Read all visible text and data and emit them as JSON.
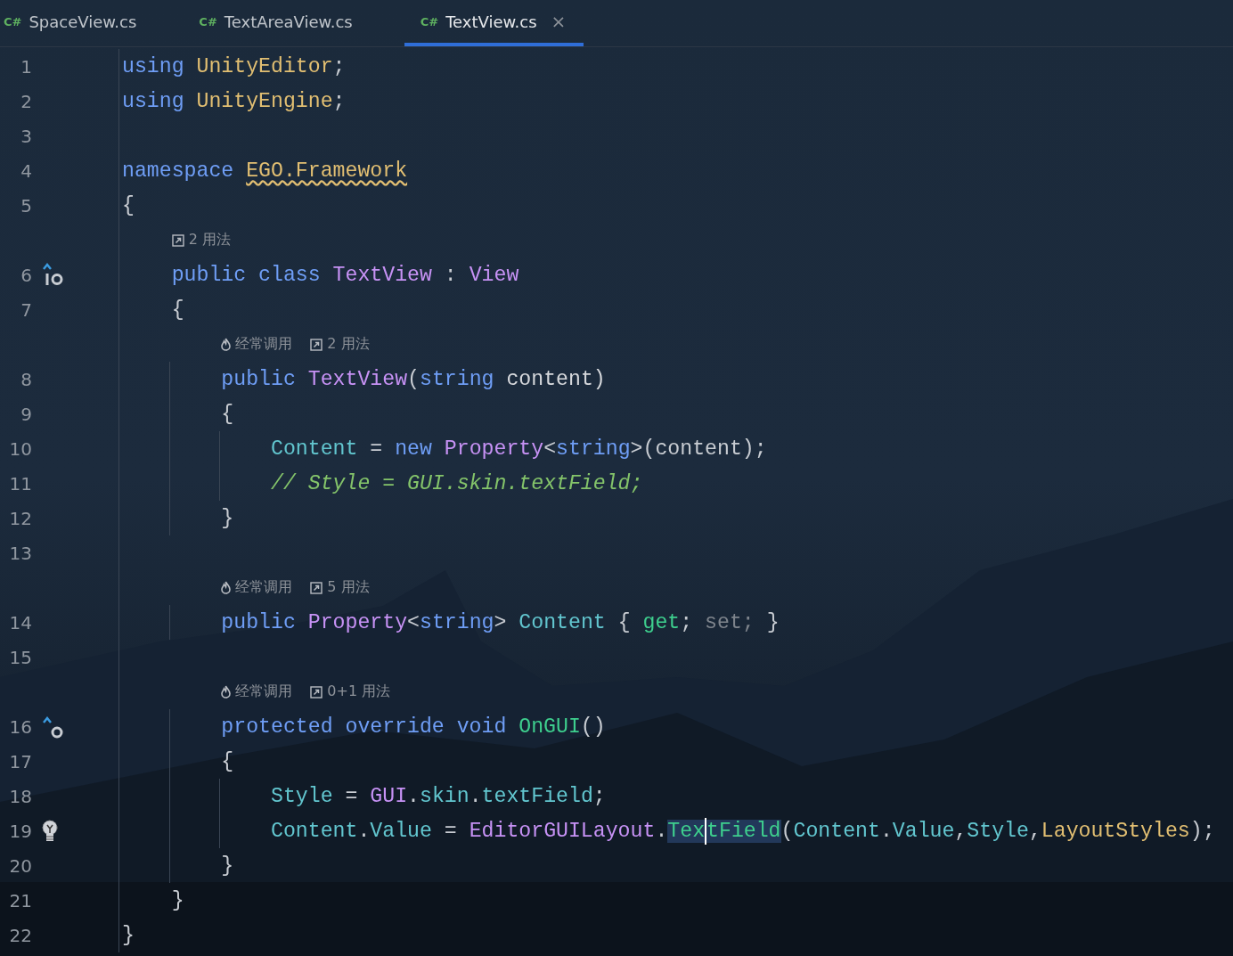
{
  "tabs": [
    {
      "icon_text": "C#",
      "label": "SpaceView.cs",
      "selected": false
    },
    {
      "icon_text": "C#",
      "label": "TextAreaView.cs",
      "selected": false
    },
    {
      "icon_text": "C#",
      "label": "TextView.cs",
      "selected": true,
      "close": "×"
    }
  ],
  "rows": [
    {
      "kind": "code",
      "number": "1",
      "tokens": [
        {
          "text": "using ",
          "kind": "kw"
        },
        {
          "text": "UnityEditor",
          "kind": "ns"
        },
        {
          "text": ";",
          "kind": "punct"
        }
      ]
    },
    {
      "kind": "code",
      "number": "2",
      "tokens": [
        {
          "text": "using ",
          "kind": "kw"
        },
        {
          "text": "UnityEngine",
          "kind": "ns"
        },
        {
          "text": ";",
          "kind": "punct"
        }
      ]
    },
    {
      "kind": "code",
      "number": "3"
    },
    {
      "kind": "code",
      "number": "4",
      "tokens": [
        {
          "text": "namespace ",
          "kind": "kw"
        },
        {
          "text": "EGO.Framework",
          "kind": "warn"
        }
      ]
    },
    {
      "kind": "code",
      "number": "5",
      "tokens": [
        {
          "text": "{",
          "kind": "punct"
        }
      ]
    },
    {
      "kind": "hint",
      "items": [
        {
          "kind": "usages",
          "text": "2 用法"
        }
      ]
    },
    {
      "kind": "code",
      "number": "6",
      "gutter_icon": {
        "kind": "implemented"
      },
      "tokens": [
        {
          "text": "    public class ",
          "kind": "kw"
        },
        {
          "text": "TextView",
          "kind": "type"
        },
        {
          "text": " : ",
          "kind": "punct"
        },
        {
          "text": "View",
          "kind": "type"
        }
      ]
    },
    {
      "kind": "code",
      "number": "7",
      "tokens": [
        {
          "text": "    {",
          "kind": "punct"
        }
      ]
    },
    {
      "kind": "hint",
      "items": [
        {
          "kind": "hot",
          "text": "经常调用"
        },
        {
          "kind": "usages",
          "text": "2 用法"
        }
      ]
    },
    {
      "kind": "code",
      "number": "8",
      "tokens": [
        {
          "text": "        public ",
          "kind": "kw"
        },
        {
          "text": "TextView",
          "kind": "type"
        },
        {
          "text": "(",
          "kind": "punct"
        },
        {
          "text": "string",
          "kind": "kw"
        },
        {
          "text": " content)",
          "kind": "param"
        }
      ]
    },
    {
      "kind": "code",
      "number": "9",
      "tokens": [
        {
          "text": "        {",
          "kind": "punct"
        }
      ]
    },
    {
      "kind": "code",
      "number": "10",
      "tokens": [
        {
          "text": "            Content",
          "kind": "prop"
        },
        {
          "text": " = ",
          "kind": "punct"
        },
        {
          "text": "new ",
          "kind": "kw"
        },
        {
          "text": "Property",
          "kind": "type"
        },
        {
          "text": "<",
          "kind": "punct"
        },
        {
          "text": "string",
          "kind": "kw"
        },
        {
          "text": ">(content);",
          "kind": "punct"
        }
      ]
    },
    {
      "kind": "code",
      "number": "11",
      "tokens": [
        {
          "text": "            // Style = GUI.skin.textField;",
          "kind": "comment"
        }
      ]
    },
    {
      "kind": "code",
      "number": "12",
      "tokens": [
        {
          "text": "        }",
          "kind": "punct"
        }
      ]
    },
    {
      "kind": "code",
      "number": "13"
    },
    {
      "kind": "hint",
      "items": [
        {
          "kind": "hot",
          "text": "经常调用"
        },
        {
          "kind": "usages",
          "text": "5 用法"
        }
      ]
    },
    {
      "kind": "code",
      "number": "14",
      "tokens": [
        {
          "text": "        public ",
          "kind": "kw"
        },
        {
          "text": "Property",
          "kind": "type"
        },
        {
          "text": "<",
          "kind": "punct"
        },
        {
          "text": "string",
          "kind": "kw"
        },
        {
          "text": "> ",
          "kind": "punct"
        },
        {
          "text": "Content",
          "kind": "prop"
        },
        {
          "text": " { ",
          "kind": "punct"
        },
        {
          "text": "get",
          "kind": "method"
        },
        {
          "text": "; ",
          "kind": "punct"
        },
        {
          "text": "set;",
          "kind": "dim"
        },
        {
          "text": " }",
          "kind": "punct"
        }
      ]
    },
    {
      "kind": "code",
      "number": "15"
    },
    {
      "kind": "hint",
      "items": [
        {
          "kind": "hot",
          "text": "经常调用"
        },
        {
          "kind": "usages",
          "text": "0+1 用法"
        }
      ]
    },
    {
      "kind": "code",
      "number": "16",
      "gutter_icon": {
        "kind": "override"
      },
      "tokens": [
        {
          "text": "        protected override void ",
          "kind": "kw"
        },
        {
          "text": "OnGUI",
          "kind": "method"
        },
        {
          "text": "()",
          "kind": "punct"
        }
      ]
    },
    {
      "kind": "code",
      "number": "17",
      "tokens": [
        {
          "text": "        {",
          "kind": "punct"
        }
      ]
    },
    {
      "kind": "code",
      "number": "18",
      "tokens": [
        {
          "text": "            Style",
          "kind": "prop"
        },
        {
          "text": " = ",
          "kind": "punct"
        },
        {
          "text": "GUI",
          "kind": "type"
        },
        {
          "text": ".",
          "kind": "punct"
        },
        {
          "text": "skin",
          "kind": "prop"
        },
        {
          "text": ".",
          "kind": "punct"
        },
        {
          "text": "textField",
          "kind": "prop"
        },
        {
          "text": ";",
          "kind": "punct"
        }
      ]
    },
    {
      "kind": "code",
      "number": "19",
      "gutter_icon": {
        "kind": "bulb"
      },
      "tokens": [
        {
          "text": "            Content",
          "kind": "prop"
        },
        {
          "text": ".",
          "kind": "punct"
        },
        {
          "text": "Value",
          "kind": "prop"
        },
        {
          "text": " = ",
          "kind": "punct"
        },
        {
          "text": "EditorGUILayout",
          "kind": "type"
        },
        {
          "text": ".",
          "kind": "punct"
        },
        {
          "text": "Tex",
          "kind": "hl"
        },
        {
          "kind": "caret"
        },
        {
          "text": "tField",
          "kind": "hl"
        },
        {
          "text": "(",
          "kind": "punct"
        },
        {
          "text": "Content",
          "kind": "prop"
        },
        {
          "text": ".",
          "kind": "punct"
        },
        {
          "text": "Value",
          "kind": "prop"
        },
        {
          "text": ",",
          "kind": "punct"
        },
        {
          "text": "Style",
          "kind": "prop"
        },
        {
          "text": ",",
          "kind": "punct"
        },
        {
          "text": "LayoutStyles",
          "kind": "ns"
        },
        {
          "text": ");",
          "kind": "punct"
        }
      ]
    },
    {
      "kind": "code",
      "number": "20",
      "tokens": [
        {
          "text": "        }",
          "kind": "punct"
        }
      ]
    },
    {
      "kind": "code",
      "number": "21",
      "tokens": [
        {
          "text": "    }",
          "kind": "punct"
        }
      ]
    },
    {
      "kind": "code",
      "number": "22",
      "tokens": [
        {
          "text": "}",
          "kind": "punct"
        }
      ]
    }
  ]
}
